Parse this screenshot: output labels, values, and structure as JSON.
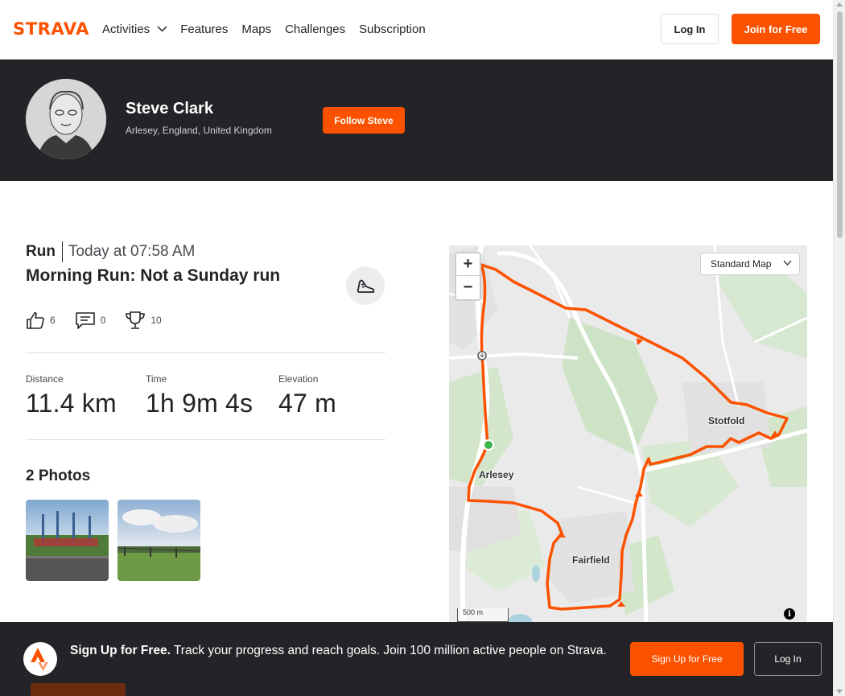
{
  "brand": {
    "name": "STRAVA",
    "accent": "#fc5200"
  },
  "nav": {
    "items": [
      {
        "label": "Activities",
        "has_dropdown": true
      },
      {
        "label": "Features",
        "has_dropdown": false
      },
      {
        "label": "Maps",
        "has_dropdown": false
      },
      {
        "label": "Challenges",
        "has_dropdown": false
      },
      {
        "label": "Subscription",
        "has_dropdown": false
      }
    ],
    "login_label": "Log In",
    "join_label": "Join for Free"
  },
  "athlete": {
    "name": "Steve Clark",
    "location": "Arlesey, England, United Kingdom",
    "follow_label": "Follow Steve"
  },
  "activity": {
    "type": "Run",
    "date": "Today at 07:58 AM",
    "title": "Morning Run: Not a Sunday run",
    "sport_icon": "shoe-icon",
    "kudos_count": "6",
    "comments_count": "0",
    "achievements_count": "10",
    "stats": [
      {
        "label": "Distance",
        "value": "11.4 km"
      },
      {
        "label": "Time",
        "value": "1h 9m 4s"
      },
      {
        "label": "Elevation",
        "value": "47 m"
      }
    ],
    "photos_title": "2 Photos"
  },
  "map": {
    "style_label": "Standard Map",
    "zoom_in": "+",
    "zoom_out": "−",
    "scale_label": "500 m",
    "info_label": "i",
    "labels": {
      "stotfold": "Stotfold",
      "arlesey": "Arlesey",
      "fairfield": "Fairfield"
    },
    "route_color": "#fc5200"
  },
  "banner": {
    "headline": "Sign Up for Free.",
    "text": "Track your progress and reach goals. Join 100 million active people on Strava.",
    "signup_label": "Sign Up for Free",
    "login_label": "Log In"
  }
}
